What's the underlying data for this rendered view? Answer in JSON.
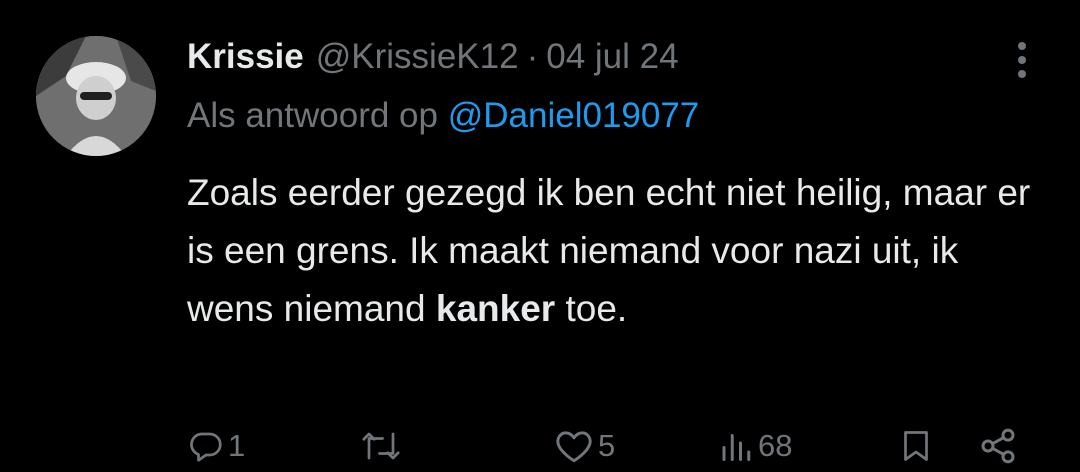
{
  "tweet": {
    "name": "Krissie",
    "handle": "@KrissieK12",
    "separator": "·",
    "date": "04 jul 24",
    "reply_prefix": "Als antwoord op",
    "reply_mention": "@Daniel019077",
    "text_before": "Zoals eerder gezegd ik ben echt niet heilig, maar er is een grens. Ik maakt niemand voor nazi uit, ik wens niemand",
    "text_bold": "kanker",
    "text_after": "toe."
  },
  "actions": {
    "reply_count": "1",
    "retweet_count": "",
    "like_count": "5",
    "views_count": "68"
  },
  "icons": {
    "avatar": "avatar",
    "more": "more-vertical-icon",
    "reply": "reply-icon",
    "retweet": "retweet-icon",
    "like": "heart-icon",
    "views": "views-icon",
    "bookmark": "bookmark-icon",
    "share": "share-icon"
  },
  "colors": {
    "background": "#000000",
    "text": "#e7e9ea",
    "muted": "#71767b",
    "mention": "#1d9bf0"
  }
}
